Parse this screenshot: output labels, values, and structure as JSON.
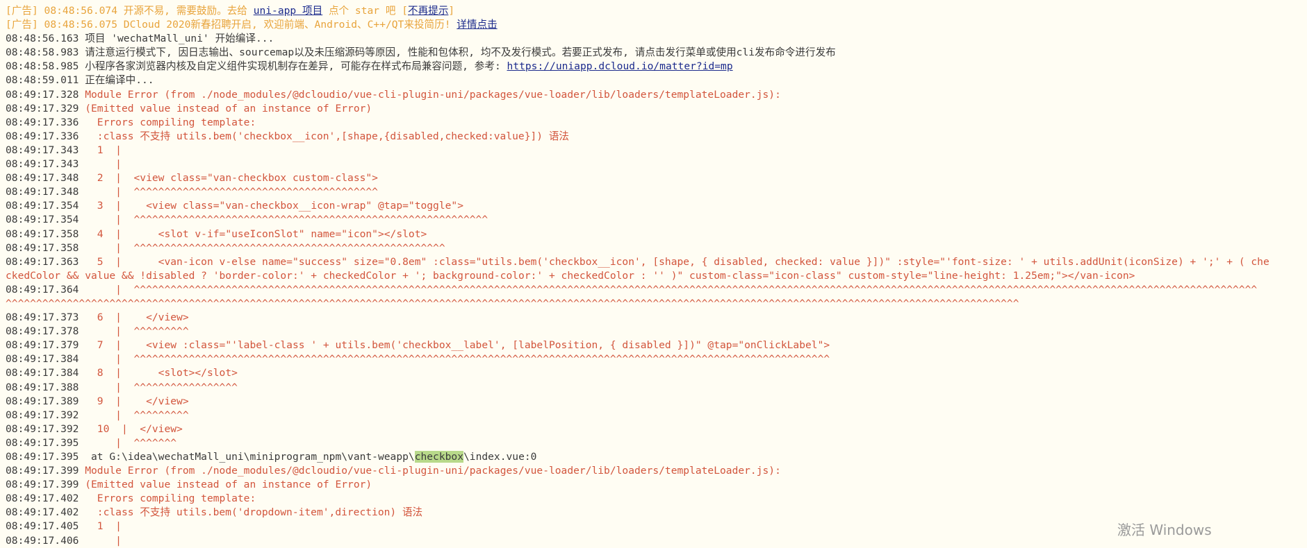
{
  "lines": [
    {
      "parts": [
        {
          "t": "[广告] ",
          "c": "ad"
        },
        {
          "t": "08:48:56.074 ",
          "c": "ad"
        },
        {
          "t": "开源不易, 需要鼓励。去给 ",
          "c": "ad"
        },
        {
          "t": "uni-app 项目",
          "c": "link"
        },
        {
          "t": " 点个 star 吧 [",
          "c": "ad"
        },
        {
          "t": "不再提示",
          "c": "link"
        },
        {
          "t": "]",
          "c": "ad"
        }
      ]
    },
    {
      "parts": [
        {
          "t": "[广告] ",
          "c": "ad"
        },
        {
          "t": "08:48:56.075 ",
          "c": "ad"
        },
        {
          "t": "DCloud 2020新春招聘开启, 欢迎前端、Android、C++/QT来投简历! ",
          "c": "ad"
        },
        {
          "t": "详情点击",
          "c": "link"
        }
      ]
    },
    {
      "parts": [
        {
          "t": "08:48:56.163 ",
          "c": "ts"
        },
        {
          "t": "项目 'wechatMall_uni' 开始编译...",
          "c": "norm"
        }
      ]
    },
    {
      "parts": [
        {
          "t": "08:48:58.983 ",
          "c": "ts"
        },
        {
          "t": "请注意运行模式下, 因日志输出、sourcemap以及未压缩源码等原因, 性能和包体积, 均不及发行模式。若要正式发布, 请点击发行菜单或使用cli发布命令进行发布",
          "c": "norm"
        }
      ]
    },
    {
      "parts": [
        {
          "t": "08:48:58.985 ",
          "c": "ts"
        },
        {
          "t": "小程序各家浏览器内核及自定义组件实现机制存在差异, 可能存在样式布局兼容问题, 参考: ",
          "c": "norm"
        },
        {
          "t": "https://uniapp.dcloud.io/matter?id=mp",
          "c": "link"
        }
      ]
    },
    {
      "parts": [
        {
          "t": "08:48:59.011 ",
          "c": "ts"
        },
        {
          "t": "正在编译中...",
          "c": "norm"
        }
      ]
    },
    {
      "parts": [
        {
          "t": "08:49:17.328 ",
          "c": "ts"
        },
        {
          "t": "Module Error (from ./node_modules/@dcloudio/vue-cli-plugin-uni/packages/vue-loader/lib/loaders/templateLoader.js):",
          "c": "err"
        }
      ]
    },
    {
      "parts": [
        {
          "t": "08:49:17.329 ",
          "c": "ts"
        },
        {
          "t": "(Emitted value instead of an instance of Error)",
          "c": "err"
        }
      ]
    },
    {
      "parts": [
        {
          "t": "08:49:17.336 ",
          "c": "ts"
        },
        {
          "t": "  Errors compiling template:",
          "c": "err"
        }
      ]
    },
    {
      "parts": [
        {
          "t": "08:49:17.336 ",
          "c": "ts"
        },
        {
          "t": "  :class 不支持 utils.bem('checkbox__icon',[shape,{disabled,checked:value}]) 语法",
          "c": "err"
        }
      ]
    },
    {
      "parts": [
        {
          "t": "08:49:17.343 ",
          "c": "ts"
        },
        {
          "t": "  1  |",
          "c": "err"
        }
      ]
    },
    {
      "parts": [
        {
          "t": "08:49:17.343 ",
          "c": "ts"
        },
        {
          "t": "     |",
          "c": "err"
        }
      ]
    },
    {
      "parts": [
        {
          "t": "08:49:17.348 ",
          "c": "ts"
        },
        {
          "t": "  2  |  <view class=\"van-checkbox custom-class\">",
          "c": "err"
        }
      ]
    },
    {
      "parts": [
        {
          "t": "08:49:17.348 ",
          "c": "ts"
        },
        {
          "t": "     |  ^^^^^^^^^^^^^^^^^^^^^^^^^^^^^^^^^^^^^^^^",
          "c": "err"
        }
      ]
    },
    {
      "parts": [
        {
          "t": "08:49:17.354 ",
          "c": "ts"
        },
        {
          "t": "  3  |    <view class=\"van-checkbox__icon-wrap\" @tap=\"toggle\">",
          "c": "err"
        }
      ]
    },
    {
      "parts": [
        {
          "t": "08:49:17.354 ",
          "c": "ts"
        },
        {
          "t": "     |  ^^^^^^^^^^^^^^^^^^^^^^^^^^^^^^^^^^^^^^^^^^^^^^^^^^^^^^^^^^",
          "c": "err"
        }
      ]
    },
    {
      "parts": [
        {
          "t": "08:49:17.358 ",
          "c": "ts"
        },
        {
          "t": "  4  |      <slot v-if=\"useIconSlot\" name=\"icon\"></slot>",
          "c": "err"
        }
      ]
    },
    {
      "parts": [
        {
          "t": "08:49:17.358 ",
          "c": "ts"
        },
        {
          "t": "     |  ^^^^^^^^^^^^^^^^^^^^^^^^^^^^^^^^^^^^^^^^^^^^^^^^^^^",
          "c": "err"
        }
      ]
    },
    {
      "parts": [
        {
          "t": "08:49:17.363 ",
          "c": "ts"
        },
        {
          "t": "  5  |      <van-icon v-else name=\"success\" size=\"0.8em\" :class=\"utils.bem('checkbox__icon', [shape, { disabled, checked: value }])\" :style=\"'font-size: ' + utils.addUnit(iconSize) + ';' + ( che",
          "c": "err"
        }
      ]
    },
    {
      "parts": [
        {
          "t": "ckedColor && value && !disabled ? 'border-color:' + checkedColor + '; background-color:' + checkedColor : '' )\" custom-class=\"icon-class\" custom-style=\"line-height: 1.25em;\"></van-icon>",
          "c": "err"
        }
      ]
    },
    {
      "parts": [
        {
          "t": "08:49:17.364 ",
          "c": "ts"
        },
        {
          "t": "     |  ^^^^^^^^^^^^^^^^^^^^^^^^^^^^^^^^^^^^^^^^^^^^^^^^^^^^^^^^^^^^^^^^^^^^^^^^^^^^^^^^^^^^^^^^^^^^^^^^^^^^^^^^^^^^^^^^^^^^^^^^^^^^^^^^^^^^^^^^^^^^^^^^^^^^^^^^^^^^^^^^^^^^^^^^^^^^^^^^^^^^^^^^",
          "c": "err"
        }
      ]
    },
    {
      "parts": [
        {
          "t": "^^^^^^^^^^^^^^^^^^^^^^^^^^^^^^^^^^^^^^^^^^^^^^^^^^^^^^^^^^^^^^^^^^^^^^^^^^^^^^^^^^^^^^^^^^^^^^^^^^^^^^^^^^^^^^^^^^^^^^^^^^^^^^^^^^^^^^^^^^^^^^^^^^^^^^^^^^^^^^^^^^^^^^",
          "c": "err"
        }
      ]
    },
    {
      "parts": [
        {
          "t": "08:49:17.373 ",
          "c": "ts"
        },
        {
          "t": "  6  |    </view>",
          "c": "err"
        }
      ]
    },
    {
      "parts": [
        {
          "t": "08:49:17.378 ",
          "c": "ts"
        },
        {
          "t": "     |  ^^^^^^^^^",
          "c": "err"
        }
      ]
    },
    {
      "parts": [
        {
          "t": "08:49:17.379 ",
          "c": "ts"
        },
        {
          "t": "  7  |    <view :class=\"'label-class ' + utils.bem('checkbox__label', [labelPosition, { disabled }])\" @tap=\"onClickLabel\">",
          "c": "err"
        }
      ]
    },
    {
      "parts": [
        {
          "t": "08:49:17.384 ",
          "c": "ts"
        },
        {
          "t": "     |  ^^^^^^^^^^^^^^^^^^^^^^^^^^^^^^^^^^^^^^^^^^^^^^^^^^^^^^^^^^^^^^^^^^^^^^^^^^^^^^^^^^^^^^^^^^^^^^^^^^^^^^^^^^^^^^^^^^",
          "c": "err"
        }
      ]
    },
    {
      "parts": [
        {
          "t": "08:49:17.384 ",
          "c": "ts"
        },
        {
          "t": "  8  |      <slot></slot>",
          "c": "err"
        }
      ]
    },
    {
      "parts": [
        {
          "t": "08:49:17.388 ",
          "c": "ts"
        },
        {
          "t": "     |  ^^^^^^^^^^^^^^^^^",
          "c": "err"
        }
      ]
    },
    {
      "parts": [
        {
          "t": "08:49:17.389 ",
          "c": "ts"
        },
        {
          "t": "  9  |    </view>",
          "c": "err"
        }
      ]
    },
    {
      "parts": [
        {
          "t": "08:49:17.392 ",
          "c": "ts"
        },
        {
          "t": "     |  ^^^^^^^^^",
          "c": "err"
        }
      ]
    },
    {
      "parts": [
        {
          "t": "08:49:17.392 ",
          "c": "ts"
        },
        {
          "t": "  10  |  </view>",
          "c": "err"
        }
      ]
    },
    {
      "parts": [
        {
          "t": "08:49:17.395 ",
          "c": "ts"
        },
        {
          "t": "     |  ^^^^^^^",
          "c": "err"
        }
      ]
    },
    {
      "parts": [
        {
          "t": "08:49:17.395 ",
          "c": "ts"
        },
        {
          "t": " at G:\\idea\\wechatMall_uni\\miniprogram_npm\\vant-weapp\\",
          "c": "norm"
        },
        {
          "t": "checkbox",
          "c": "hl"
        },
        {
          "t": "\\index.vue:0",
          "c": "norm"
        }
      ]
    },
    {
      "parts": [
        {
          "t": "08:49:17.399 ",
          "c": "ts"
        },
        {
          "t": "Module Error (from ./node_modules/@dcloudio/vue-cli-plugin-uni/packages/vue-loader/lib/loaders/templateLoader.js):",
          "c": "err"
        }
      ]
    },
    {
      "parts": [
        {
          "t": "08:49:17.399 ",
          "c": "ts"
        },
        {
          "t": "(Emitted value instead of an instance of Error)",
          "c": "err"
        }
      ]
    },
    {
      "parts": [
        {
          "t": "08:49:17.402 ",
          "c": "ts"
        },
        {
          "t": "  Errors compiling template:",
          "c": "err"
        }
      ]
    },
    {
      "parts": [
        {
          "t": "08:49:17.402 ",
          "c": "ts"
        },
        {
          "t": "  :class 不支持 utils.bem('dropdown-item',direction) 语法",
          "c": "err"
        }
      ]
    },
    {
      "parts": [
        {
          "t": "08:49:17.405 ",
          "c": "ts"
        },
        {
          "t": "  1  |",
          "c": "err"
        }
      ]
    },
    {
      "parts": [
        {
          "t": "08:49:17.406 ",
          "c": "ts"
        },
        {
          "t": "     |",
          "c": "err"
        }
      ]
    }
  ],
  "watermark": "激活 Windows",
  "colors": {
    "background": "#fffdf3",
    "ad": "#e8a43c",
    "error": "#d2553c",
    "link": "#1b2a8c",
    "highlight": "#b8d98a"
  }
}
